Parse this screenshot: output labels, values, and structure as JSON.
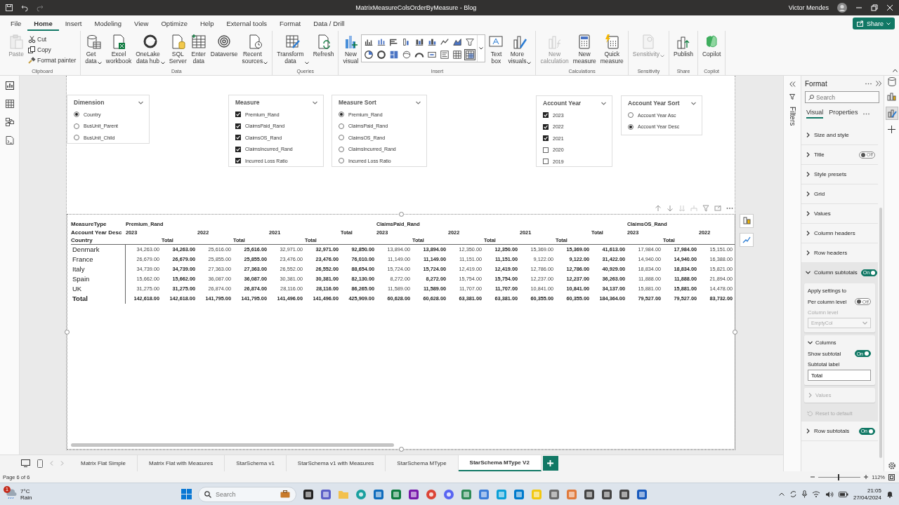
{
  "window": {
    "title": "MatrixMeasureColsOrderByMeasure - Blog",
    "user": "Victor Mendes"
  },
  "menu_tabs": [
    {
      "label": "File",
      "selected": false
    },
    {
      "label": "Home",
      "selected": true
    },
    {
      "label": "Insert",
      "selected": false
    },
    {
      "label": "Modeling",
      "selected": false
    },
    {
      "label": "View",
      "selected": false
    },
    {
      "label": "Optimize",
      "selected": false
    },
    {
      "label": "Help",
      "selected": false
    },
    {
      "label": "External tools",
      "selected": false
    },
    {
      "label": "Format",
      "selected": false
    },
    {
      "label": "Data / Drill",
      "selected": false
    }
  ],
  "share_button": "Share",
  "ribbon_groups": [
    {
      "label": "Clipboard",
      "items": [
        {
          "kind": "large",
          "lines": [
            "Paste"
          ],
          "disabled": true,
          "dropdown": false
        },
        {
          "kind": "small",
          "lines": [
            "Cut"
          ],
          "disabled": false,
          "dropdown": false
        },
        {
          "kind": "small",
          "lines": [
            "Copy"
          ],
          "disabled": false,
          "dropdown": false
        },
        {
          "kind": "small",
          "lines": [
            "Format painter"
          ],
          "disabled": false,
          "dropdown": false
        }
      ]
    },
    {
      "label": "Data",
      "items": [
        {
          "kind": "large",
          "lines": [
            "Get",
            "data"
          ],
          "disabled": false,
          "dropdown": true
        },
        {
          "kind": "large",
          "lines": [
            "Excel",
            "workbook"
          ],
          "disabled": false,
          "dropdown": false
        },
        {
          "kind": "large",
          "lines": [
            "OneLake",
            "data hub"
          ],
          "disabled": false,
          "dropdown": true
        },
        {
          "kind": "large",
          "lines": [
            "SQL",
            "Server"
          ],
          "disabled": false,
          "dropdown": false
        },
        {
          "kind": "large",
          "lines": [
            "Enter",
            "data"
          ],
          "disabled": false,
          "dropdown": false
        },
        {
          "kind": "large",
          "lines": [
            "Dataverse"
          ],
          "disabled": false,
          "dropdown": false
        },
        {
          "kind": "large",
          "lines": [
            "Recent",
            "sources"
          ],
          "disabled": false,
          "dropdown": true
        }
      ]
    },
    {
      "label": "Queries",
      "items": [
        {
          "kind": "large",
          "lines": [
            "Transform",
            "data"
          ],
          "disabled": false,
          "dropdown": true
        },
        {
          "kind": "large",
          "lines": [
            "Refresh"
          ],
          "disabled": false,
          "dropdown": false
        }
      ]
    },
    {
      "label": "Insert",
      "items": [
        {
          "kind": "large",
          "lines": [
            "New",
            "visual"
          ],
          "disabled": false,
          "dropdown": false
        },
        {
          "kind": "gallery",
          "visuals": [
            {
              "selected": false
            },
            {
              "selected": false
            },
            {
              "selected": false
            },
            {
              "selected": false
            },
            {
              "selected": false
            },
            {
              "selected": false
            },
            {
              "selected": false
            },
            {
              "selected": false
            },
            {
              "selected": false
            },
            {
              "selected": false
            },
            {
              "selected": false
            },
            {
              "selected": false
            },
            {
              "selected": false
            },
            {
              "selected": false
            },
            {
              "selected": false
            },
            {
              "selected": false
            },
            {
              "selected": false
            },
            {
              "selected": true
            }
          ]
        },
        {
          "kind": "large",
          "lines": [
            "Text",
            "box"
          ],
          "disabled": false,
          "dropdown": false
        },
        {
          "kind": "large",
          "lines": [
            "More",
            "visuals"
          ],
          "disabled": false,
          "dropdown": true
        }
      ]
    },
    {
      "label": "Calculations",
      "items": [
        {
          "kind": "large",
          "lines": [
            "New",
            "calculation"
          ],
          "disabled": true,
          "dropdown": false
        },
        {
          "kind": "large",
          "lines": [
            "New",
            "measure"
          ],
          "disabled": false,
          "dropdown": false
        },
        {
          "kind": "large",
          "lines": [
            "Quick",
            "measure"
          ],
          "disabled": false,
          "dropdown": false
        }
      ]
    },
    {
      "label": "Sensitivity",
      "items": [
        {
          "kind": "large",
          "lines": [
            "Sensitivity"
          ],
          "disabled": true,
          "dropdown": true
        }
      ]
    },
    {
      "label": "Share",
      "items": [
        {
          "kind": "large",
          "lines": [
            "Publish"
          ],
          "disabled": false,
          "dropdown": false
        }
      ]
    },
    {
      "label": "Copilot",
      "items": [
        {
          "kind": "large",
          "lines": [
            "Copilot"
          ],
          "disabled": false,
          "dropdown": false
        }
      ]
    }
  ],
  "slicers": [
    {
      "title": "Dimension",
      "kind": "radio",
      "options": [
        {
          "label": "Country",
          "selected": true
        },
        {
          "label": "BusUnit_Parent",
          "selected": false
        },
        {
          "label": "BusUnit_Child",
          "selected": false
        }
      ]
    },
    {
      "title": "Measure",
      "kind": "checkbox",
      "options": [
        {
          "label": "Premium_Rand",
          "checked": true
        },
        {
          "label": "ClaimsPaid_Rand",
          "checked": true
        },
        {
          "label": "ClaimsOS_Rand",
          "checked": true
        },
        {
          "label": "ClaimsIncurred_Rand",
          "checked": true
        },
        {
          "label": "Incurred Loss Ratio",
          "checked": true
        }
      ]
    },
    {
      "title": "Measure Sort",
      "kind": "radio",
      "options": [
        {
          "label": "Premium_Rand",
          "selected": true
        },
        {
          "label": "ClaimsPaid_Rand",
          "selected": false
        },
        {
          "label": "ClaimsOS_Rand",
          "selected": false
        },
        {
          "label": "ClaimsIncurred_Rand",
          "selected": false
        },
        {
          "label": "Incurred Loss Ratio",
          "selected": false
        }
      ]
    },
    {
      "title": "Account Year",
      "kind": "checkbox",
      "options": [
        {
          "label": "2023",
          "checked": true
        },
        {
          "label": "2022",
          "checked": true
        },
        {
          "label": "2021",
          "checked": true
        },
        {
          "label": "2020",
          "checked": false
        },
        {
          "label": "2019",
          "checked": false
        }
      ]
    },
    {
      "title": "Account Year Sort",
      "kind": "radio",
      "options": [
        {
          "label": "Account Year Asc",
          "selected": false
        },
        {
          "label": "Account Year Desc",
          "selected": true
        }
      ]
    }
  ],
  "matrix": {
    "header_labels": [
      "MeasureType",
      "Account Year Desc",
      "Country"
    ],
    "measures": [
      {
        "label": "Premium_Rand",
        "columns": [
          {
            "kind": "year",
            "label": "2023"
          },
          {
            "kind": "subtotal",
            "label": "Total"
          },
          {
            "kind": "year",
            "label": "2022"
          },
          {
            "kind": "subtotal",
            "label": "Total"
          },
          {
            "kind": "year",
            "label": "2021"
          },
          {
            "kind": "subtotal",
            "label": "Total"
          },
          {
            "kind": "total",
            "label": "Total"
          }
        ]
      },
      {
        "label": "ClaimsPaid_Rand",
        "columns": [
          {
            "kind": "year",
            "label": "2023"
          },
          {
            "kind": "subtotal",
            "label": "Total"
          },
          {
            "kind": "year",
            "label": "2022"
          },
          {
            "kind": "subtotal",
            "label": "Total"
          },
          {
            "kind": "year",
            "label": "2021"
          },
          {
            "kind": "subtotal",
            "label": "Total"
          },
          {
            "kind": "total",
            "label": "Total"
          }
        ]
      },
      {
        "label": "ClaimsOS_Rand",
        "columns": [
          {
            "kind": "year",
            "label": "2023"
          },
          {
            "kind": "subtotal",
            "label": "Total"
          },
          {
            "kind": "year",
            "label": "2022"
          }
        ]
      }
    ],
    "rows": [
      {
        "kind": "data",
        "label": "Denmark",
        "values": [
          "34,263.00",
          "34,263.00",
          "25,616.00",
          "25,616.00",
          "32,971.00",
          "32,971.00",
          "92,850.00",
          "13,894.00",
          "13,894.00",
          "12,350.00",
          "12,350.00",
          "15,369.00",
          "15,369.00",
          "41,613.00",
          "17,984.00",
          "17,984.00",
          "15,151.00"
        ]
      },
      {
        "kind": "data",
        "label": "France",
        "values": [
          "26,679.00",
          "26,679.00",
          "25,855.00",
          "25,855.00",
          "23,476.00",
          "23,476.00",
          "76,010.00",
          "11,149.00",
          "11,149.00",
          "11,151.00",
          "11,151.00",
          "9,122.00",
          "9,122.00",
          "31,422.00",
          "14,940.00",
          "14,940.00",
          "16,388.00"
        ]
      },
      {
        "kind": "data",
        "label": "Italy",
        "values": [
          "34,739.00",
          "34,739.00",
          "27,363.00",
          "27,363.00",
          "26,552.00",
          "26,552.00",
          "88,654.00",
          "15,724.00",
          "15,724.00",
          "12,419.00",
          "12,419.00",
          "12,786.00",
          "12,786.00",
          "40,929.00",
          "18,834.00",
          "18,834.00",
          "15,821.00"
        ]
      },
      {
        "kind": "data",
        "label": "Spain",
        "values": [
          "15,662.00",
          "15,662.00",
          "36,087.00",
          "36,087.00",
          "30,381.00",
          "30,381.00",
          "82,130.00",
          "8,272.00",
          "8,272.00",
          "15,754.00",
          "15,754.00",
          "12,237.00",
          "12,237.00",
          "36,263.00",
          "11,888.00",
          "11,888.00",
          "21,894.00"
        ]
      },
      {
        "kind": "data",
        "label": "UK",
        "values": [
          "31,275.00",
          "31,275.00",
          "26,874.00",
          "26,874.00",
          "28,116.00",
          "28,116.00",
          "86,265.00",
          "11,589.00",
          "11,589.00",
          "11,707.00",
          "11,707.00",
          "10,841.00",
          "10,841.00",
          "34,137.00",
          "15,881.00",
          "15,881.00",
          "14,478.00"
        ]
      },
      {
        "kind": "total",
        "label": "Total",
        "values": [
          "142,618.00",
          "142,618.00",
          "141,795.00",
          "141,795.00",
          "141,496.00",
          "141,496.00",
          "425,909.00",
          "60,628.00",
          "60,628.00",
          "63,381.00",
          "63,381.00",
          "60,355.00",
          "60,355.00",
          "184,364.00",
          "79,527.00",
          "79,527.00",
          "83,732.00"
        ]
      }
    ]
  },
  "filters_pane": {
    "label": "Filters"
  },
  "format_pane": {
    "title": "Format",
    "search_placeholder": "Search",
    "tabs": [
      {
        "label": "Visual",
        "selected": true
      },
      {
        "label": "Properties",
        "selected": false
      }
    ],
    "sections": [
      {
        "label": "Size and style",
        "expanded": false
      },
      {
        "label": "Title",
        "expanded": false,
        "toggle": {
          "on": false,
          "text": "Off"
        }
      },
      {
        "label": "Style presets",
        "expanded": false
      },
      {
        "label": "Grid",
        "expanded": false
      },
      {
        "label": "Values",
        "expanded": false
      },
      {
        "label": "Column headers",
        "expanded": false
      },
      {
        "label": "Row headers",
        "expanded": false
      },
      {
        "label": "Column subtotals",
        "expanded": true,
        "toggle": {
          "on": true,
          "text": "On"
        },
        "content": {
          "apply_card": {
            "heading": "Apply settings to",
            "per_level_label": "Per column level",
            "per_level_toggle": {
              "on": false,
              "text": "Off"
            },
            "level_label": "Column level",
            "level_value": "EmptyCol",
            "disabled": true
          },
          "columns_card": {
            "heading": "Columns",
            "expanded": true,
            "show_label": "Show subtotal",
            "show_toggle": {
              "on": true,
              "text": "On"
            },
            "subtotal_label": "Subtotal label",
            "subtotal_value": "Total"
          },
          "values_card": {
            "heading": "Values",
            "expanded": false,
            "disabled": true
          },
          "reset": {
            "label": "Reset to default",
            "disabled": true
          }
        }
      },
      {
        "label": "Row subtotals",
        "expanded": false,
        "toggle": {
          "on": true,
          "text": "On"
        }
      }
    ]
  },
  "page_tabs": [
    {
      "label": "Matrix Flat Simple",
      "selected": false
    },
    {
      "label": "Matrix Flat with Measures",
      "selected": false
    },
    {
      "label": "StarSchema v1",
      "selected": false
    },
    {
      "label": "StarSchema v1 with Measures",
      "selected": false
    },
    {
      "label": "StarSchema MType",
      "selected": false
    },
    {
      "label": "StarSchema MType V2",
      "selected": true
    }
  ],
  "status_bar": {
    "page": "Page 6 of 6",
    "zoom": {
      "level": 0.47,
      "reading": "112%"
    }
  },
  "taskbar": {
    "weather": {
      "badge": "1",
      "temperature": "7°C",
      "condition": "Rain"
    },
    "search_placeholder": "Search",
    "clock": {
      "time": "21:05",
      "date": "27/04/2024"
    }
  }
}
